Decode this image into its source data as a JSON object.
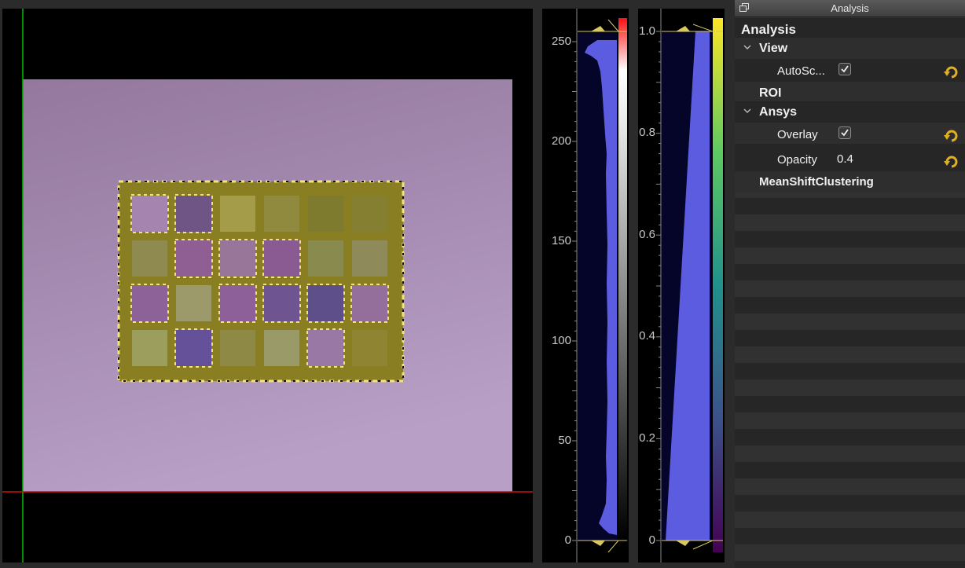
{
  "dock": {
    "title": "Analysis",
    "tree": {
      "root": "Analysis",
      "view_group": "View",
      "autoscale_label": "AutoSc...",
      "autoscale_checked": true,
      "roi_label": "ROI",
      "ansys_group": "Ansys",
      "overlay_label": "Overlay",
      "overlay_checked": true,
      "opacity_label": "Opacity",
      "opacity_value": "0.4",
      "meanshift_label": "MeanShiftClustering"
    }
  },
  "histogram_left": {
    "ticks": [
      "250",
      "200",
      "150",
      "100",
      "50",
      "0"
    ],
    "colormap": "grayscale-red",
    "fill_color": "#5b5ce0"
  },
  "histogram_right": {
    "ticks": [
      "1.0",
      "0.8",
      "0.6",
      "0.4",
      "0.2",
      "0"
    ],
    "colormap": "viridis",
    "fill_color": "#5b5ce0"
  },
  "image_view": {
    "crosshair_vertical_color": "#00c000",
    "crosshair_horizontal_color": "#d01010",
    "background_color": "#9b83ab",
    "overlay_color": "#8a7f1f"
  },
  "icons": {
    "dock_float": "float-window-icon",
    "reset": "reset-arrow-icon",
    "expand": "chevron-down-icon",
    "checkbox": "checkmark-icon"
  }
}
